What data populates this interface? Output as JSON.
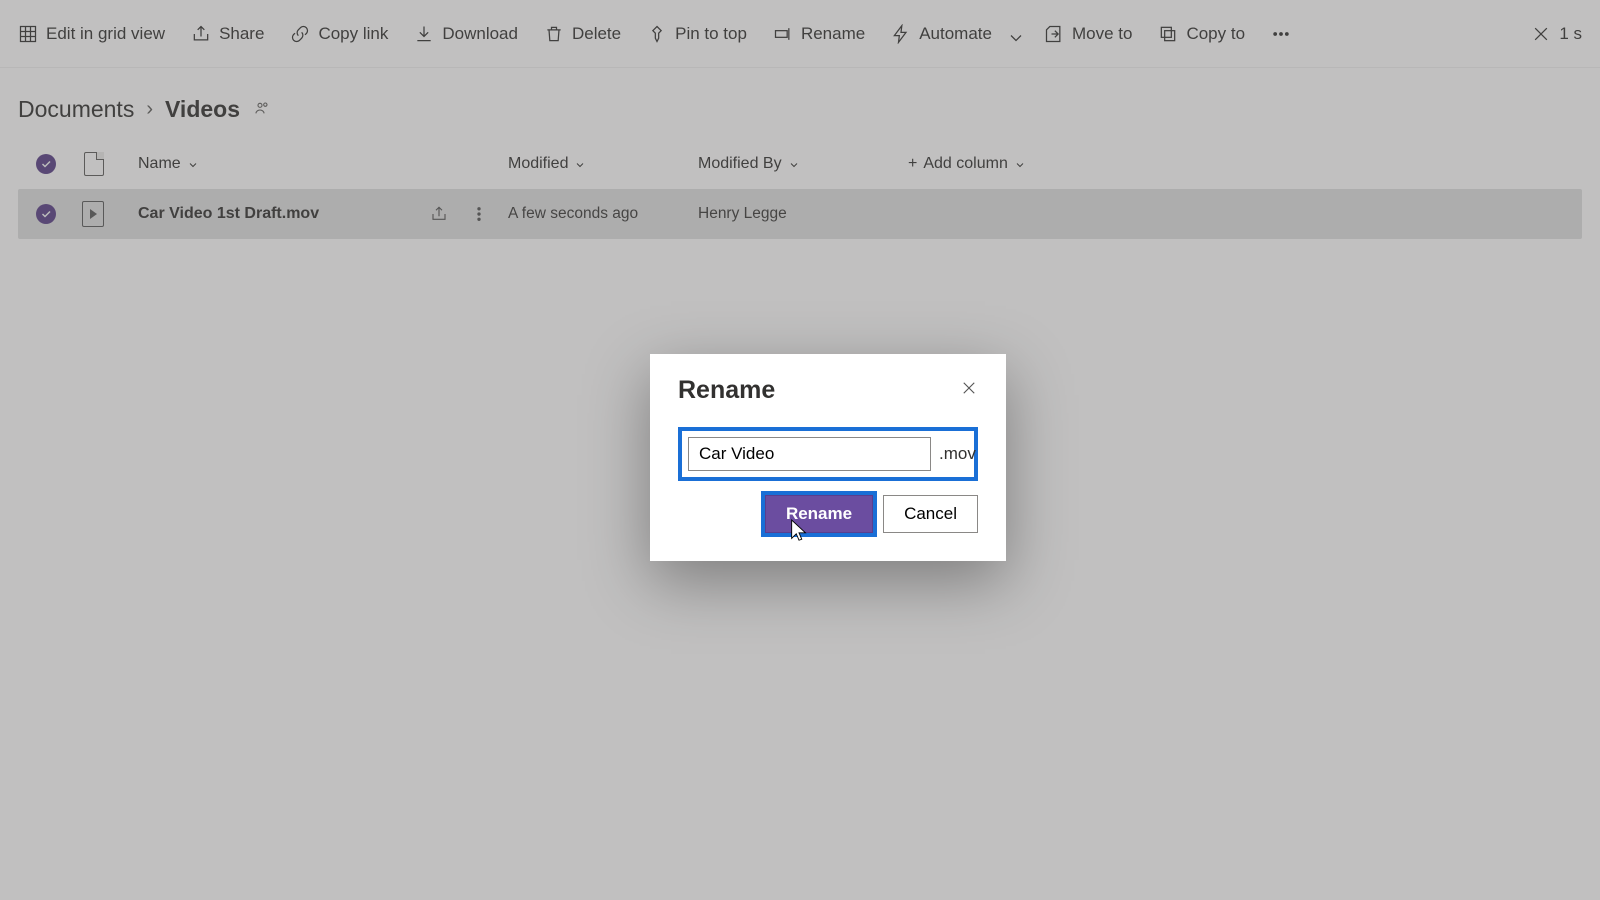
{
  "toolbar": {
    "edit_grid": "Edit in grid view",
    "share": "Share",
    "copy_link": "Copy link",
    "download": "Download",
    "delete": "Delete",
    "pin": "Pin to top",
    "rename": "Rename",
    "automate": "Automate",
    "move_to": "Move to",
    "copy_to": "Copy to",
    "selection_count": "1 s"
  },
  "breadcrumb": {
    "root": "Documents",
    "current": "Videos"
  },
  "columns": {
    "name": "Name",
    "modified": "Modified",
    "modified_by": "Modified By",
    "add": "Add column"
  },
  "rows": [
    {
      "name": "Car Video 1st Draft.mov",
      "modified": "A few seconds ago",
      "modified_by": "Henry Legge"
    }
  ],
  "dialog": {
    "title": "Rename",
    "value": "Car Video",
    "extension": ".mov",
    "confirm": "Rename",
    "cancel": "Cancel"
  }
}
